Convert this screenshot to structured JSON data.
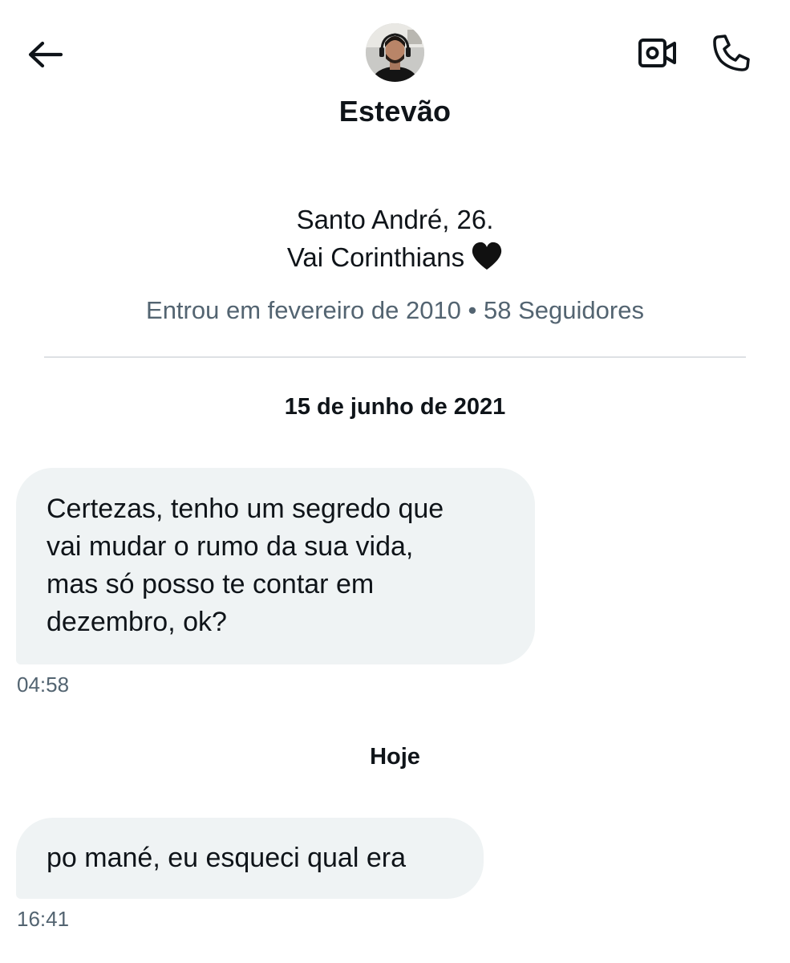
{
  "header": {
    "back_icon": "arrow-left-icon",
    "name": "Estevão",
    "video_icon": "video-camera-icon",
    "call_icon": "phone-icon"
  },
  "profile": {
    "bio_line_1": "Santo André, 26.",
    "bio_line_2": "Vai Corinthians",
    "bio_emoji": "black-heart",
    "joined": "Entrou em fevereiro de 2010",
    "separator": "•",
    "followers": "58 Seguidores"
  },
  "conversation": {
    "groups": [
      {
        "date": "15 de junho de 2021",
        "messages": [
          {
            "lines": [
              "Certezas, tenho um segredo que",
              "vai mudar o rumo da sua vida,",
              "mas só posso te contar em",
              "dezembro, ok?"
            ],
            "time": "04:58"
          }
        ]
      },
      {
        "date": "Hoje",
        "messages": [
          {
            "text": "po mané, eu esqueci qual era",
            "time": "16:41"
          }
        ]
      }
    ]
  },
  "colors": {
    "text": "#0f1419",
    "secondary": "#536471",
    "bubble": "#eff3f4",
    "divider": "#dde1e4"
  }
}
